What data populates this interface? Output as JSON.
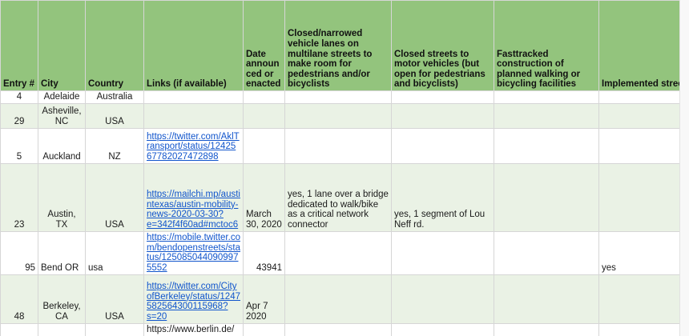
{
  "headers": [
    "Entry #",
    "City",
    "Country",
    "Links (if available)",
    "Date announced or enacted",
    "Closed/narrowed vehicle lanes on multilane streets to make room for pedestrians and/or bicyclists",
    "Closed streets to motor vehicles (but open for pedestrians and bicyclists)",
    "Fasttracked construction of planned walking or bicycling facilities",
    "Implemented streets"
  ],
  "rows": [
    {
      "entry": "4",
      "city": "Adelaide",
      "country": "Australia",
      "link": "",
      "date": "",
      "closed_lanes": "",
      "closed_streets": "",
      "fasttracked": "",
      "implemented": ""
    },
    {
      "entry": "29",
      "city": "Asheville, NC",
      "country": "USA",
      "link": "",
      "date": "",
      "closed_lanes": "",
      "closed_streets": "",
      "fasttracked": "",
      "implemented": ""
    },
    {
      "entry": "5",
      "city": "Auckland",
      "country": "NZ",
      "link": "https://twitter.com/AklTransport/status/1242567782027472898",
      "date": "",
      "closed_lanes": "",
      "closed_streets": "",
      "fasttracked": "",
      "implemented": ""
    },
    {
      "entry": "23",
      "city": "Austin, TX",
      "country": "USA",
      "link": "https://mailchi.mp/austintexas/austin-mobility-news-2020-03-30?e=342f4f60ad#mctoc6",
      "date": "March 30, 2020",
      "closed_lanes": "yes, 1 lane over a bridge dedicated to walk/bike as a critical network connector",
      "closed_streets": "yes, 1 segment of Lou Neff rd.",
      "fasttracked": "",
      "implemented": ""
    },
    {
      "entry": "95",
      "city": "Bend OR",
      "country": "usa",
      "link": "https://mobile.twitter.com/bendopenstreets/status/1250850440909975552",
      "date": "43941",
      "closed_lanes": "",
      "closed_streets": "",
      "fasttracked": "",
      "implemented": "yes"
    },
    {
      "entry": "48",
      "city": "Berkeley, CA",
      "country": "USA",
      "link": "https://twitter.com/CityofBerkeley/status/1247582564300115968?s=20",
      "date": "Apr 7 2020",
      "closed_lanes": "",
      "closed_streets": "",
      "fasttracked": "",
      "implemented": ""
    },
    {
      "entry": "",
      "city": "",
      "country": "",
      "link": "https://www.berlin.de/",
      "date": "",
      "closed_lanes": "",
      "closed_streets": "",
      "fasttracked": "",
      "implemented": ""
    }
  ]
}
